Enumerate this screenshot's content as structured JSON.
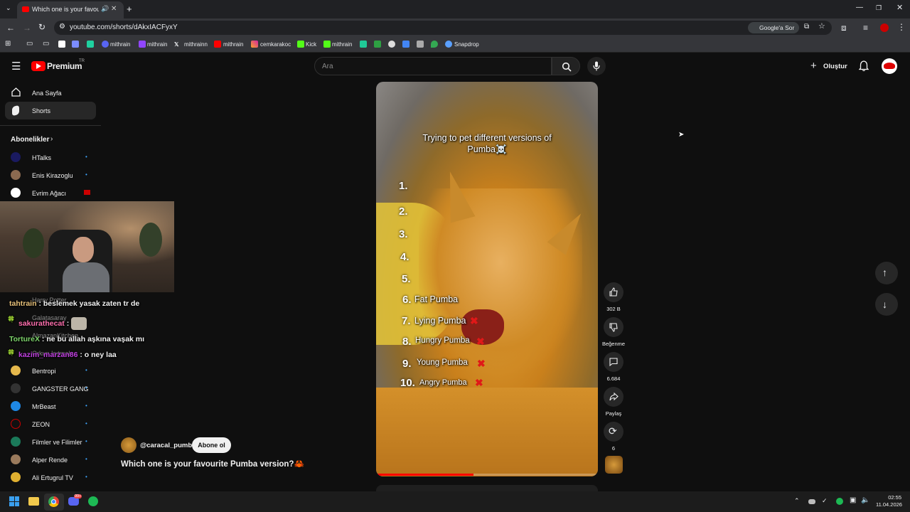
{
  "browser": {
    "tab_title": "Which one is your favourite Pumba version?",
    "url": "youtube.com/shorts/dAkxIACFyxY",
    "google_sor": "Google'a Sor",
    "bookmarks": [
      "mithrain",
      "mithrain",
      "mithrainn",
      "mithrain",
      "cemkarakoc",
      "Kick",
      "mithrain",
      "Snapdrop"
    ]
  },
  "youtube": {
    "logo": "Premium",
    "region": "TR",
    "search_placeholder": "Ara",
    "create_label": "Oluştur"
  },
  "sidebar": {
    "nav": [
      {
        "label": "Ana Sayfa"
      },
      {
        "label": "Shorts"
      }
    ],
    "subs_header": "Abonelikler",
    "subscriptions": [
      {
        "label": "HTalks"
      },
      {
        "label": "Enis Kirazoglu"
      },
      {
        "label": "Evrim Ağacı"
      },
      {
        "label": "Harry Potter"
      },
      {
        "label": "Galatasaray"
      },
      {
        "label": "AlmazanKitchen"
      },
      {
        "label": "Orkun Isıtmak"
      },
      {
        "label": "Bentropi"
      },
      {
        "label": "GANGSTER GANG"
      },
      {
        "label": "MrBeast"
      },
      {
        "label": "ZEON"
      },
      {
        "label": "Filmler ve Filimler"
      },
      {
        "label": "Alper Rende"
      },
      {
        "label": "Ali Ertugrul TV"
      }
    ]
  },
  "chat": [
    {
      "user": "tahtrain",
      "text": ": beslemek yasak zaten tr de",
      "color": "#e8c27a"
    },
    {
      "user": "sakurathecat",
      "text": ":",
      "color": "#ff6fae"
    },
    {
      "user": "TortureX",
      "text": ": ne bu allah aşkına vaşak mı",
      "color": "#7dd36b"
    },
    {
      "user": "kazim_marzan86",
      "text": ": o ney laa",
      "color": "#c040e0"
    }
  ],
  "short": {
    "overlay_title": "Trying to pet different versions of Pumba☠️",
    "list": [
      {
        "n": "1.",
        "label": ""
      },
      {
        "n": "2.",
        "label": ""
      },
      {
        "n": "3.",
        "label": ""
      },
      {
        "n": "4.",
        "label": ""
      },
      {
        "n": "5.",
        "label": ""
      },
      {
        "n": "6.",
        "label": "Fat Pumba"
      },
      {
        "n": "7.",
        "label": "Lying Pumba"
      },
      {
        "n": "8.",
        "label": "Hungry Pumba"
      },
      {
        "n": "9.",
        "label": "Young Pumba"
      },
      {
        "n": "10.",
        "label": "Angry Pumba"
      }
    ],
    "channel": "@caracal_pumba",
    "subscribe_label": "Abone ol",
    "title": "Which one is your favourite Pumba version?🦀",
    "progress": 0.44,
    "actions": {
      "likes": "302 B",
      "dislike": "Beğenme",
      "comments": "6.684",
      "share": "Paylaş",
      "remix": "6"
    }
  },
  "taskbar": {
    "time": "02:55",
    "date": "11.04.2026",
    "discord_badge": "99+"
  },
  "colors": {
    "youtube_red": "#ff0000",
    "background": "#0f0f0f",
    "link_blue": "#3ea6ff"
  }
}
